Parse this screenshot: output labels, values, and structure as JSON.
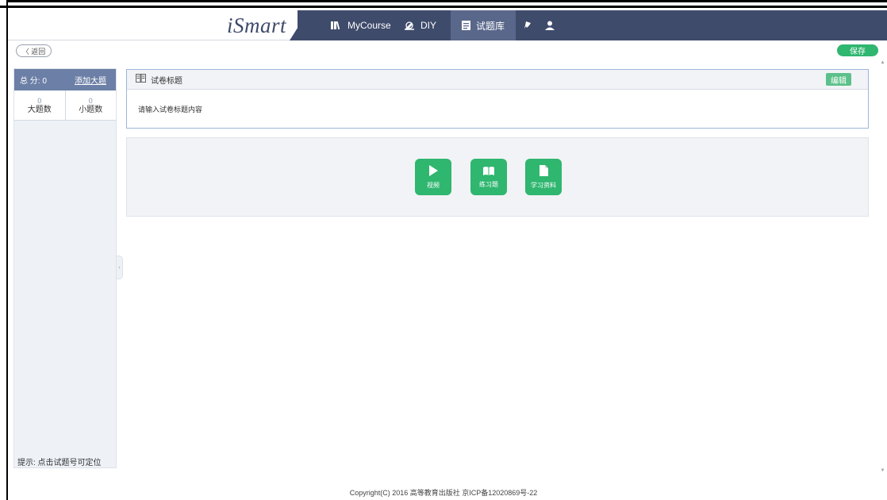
{
  "nav": {
    "logo": "iSmart",
    "items": [
      {
        "label": "MyCourse",
        "icon": "book-icon"
      },
      {
        "label": "DIY",
        "icon": "pen-icon"
      },
      {
        "label": "试题库",
        "icon": "document-icon",
        "active": true
      }
    ],
    "icons": [
      "pin-icon",
      "user-icon"
    ]
  },
  "toolbar": {
    "back_label": "〈 返回",
    "save_label": "保存"
  },
  "sidebar": {
    "score_label": "总  分: 0",
    "add_label": "添加大题",
    "stats": [
      {
        "value": "0",
        "label": "大题数"
      },
      {
        "value": "0",
        "label": "小题数"
      }
    ],
    "hint": "提示: 点击试题号可定位"
  },
  "title_card": {
    "heading": "试卷标题",
    "edit_label": "编辑",
    "placeholder": "请输入试卷标题内容"
  },
  "resources": [
    {
      "label": "视频",
      "icon": "play-icon"
    },
    {
      "label": "练习题",
      "icon": "open-book-icon"
    },
    {
      "label": "学习资料",
      "icon": "file-icon"
    }
  ],
  "footer": "Copyright(C) 2016 高等教育出版社 京ICP备12020869号-22",
  "colors": {
    "nav_bg": "#3f4b6b",
    "nav_active": "#59678a",
    "accent_green": "#2fb66f",
    "sidebar_head": "#6c7fa6"
  }
}
